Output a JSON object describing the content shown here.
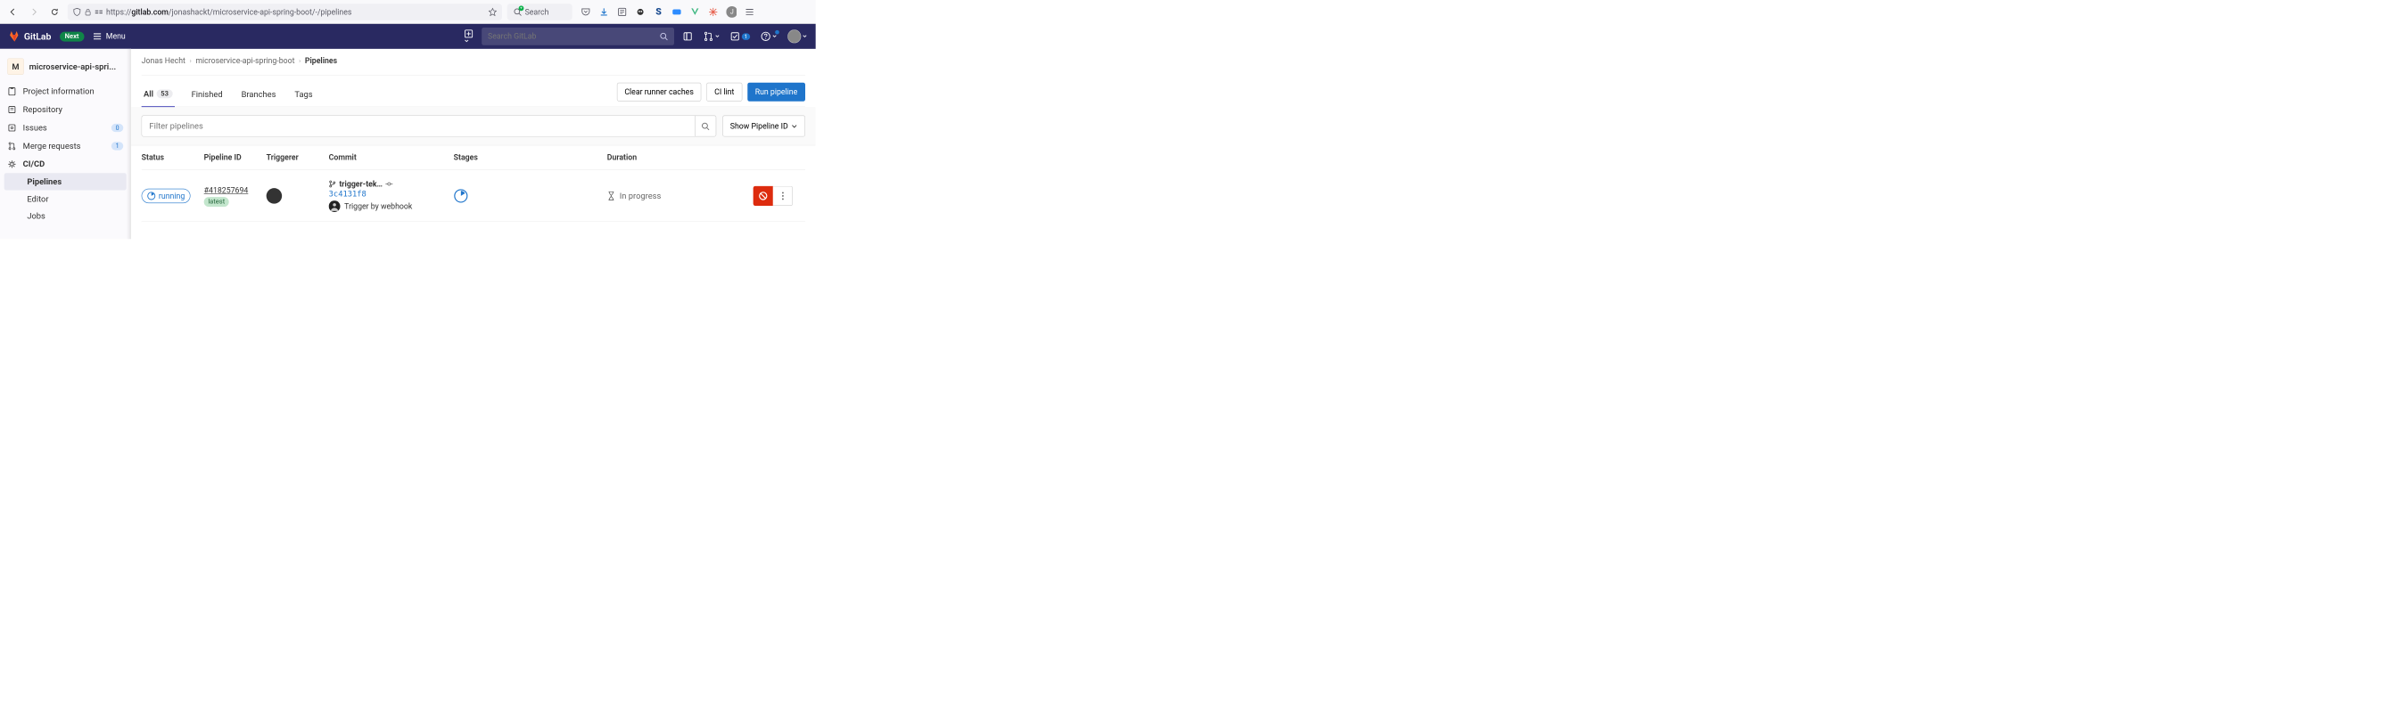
{
  "browser": {
    "url_prefix": "https://",
    "url_bold": "gitlab.com",
    "url_rest": "/jonashackt/microservice-api-spring-boot/-/pipelines",
    "search_placeholder": "Search"
  },
  "gitlab_nav": {
    "logo_text": "GitLab",
    "next_badge": "Next",
    "menu_label": "Menu",
    "search_placeholder": "Search GitLab",
    "todo_count": "1"
  },
  "sidebar": {
    "project_letter": "M",
    "project_name": "microservice-api-spri...",
    "items": [
      {
        "label": "Project information"
      },
      {
        "label": "Repository"
      },
      {
        "label": "Issues",
        "count": "0"
      },
      {
        "label": "Merge requests",
        "count": "1"
      },
      {
        "label": "CI/CD"
      }
    ],
    "subs": [
      {
        "label": "Pipelines"
      },
      {
        "label": "Editor"
      },
      {
        "label": "Jobs"
      }
    ]
  },
  "breadcrumbs": [
    "Jonas Hecht",
    "microservice-api-spring-boot",
    "Pipelines"
  ],
  "tabs": {
    "all": "All",
    "all_count": "53",
    "finished": "Finished",
    "branches": "Branches",
    "tags": "Tags"
  },
  "buttons": {
    "clear_caches": "Clear runner caches",
    "ci_lint": "CI lint",
    "run_pipeline": "Run pipeline",
    "show_pipeline": "Show Pipeline ID"
  },
  "filter_placeholder": "Filter pipelines",
  "columns": {
    "status": "Status",
    "pipeline_id": "Pipeline ID",
    "triggerer": "Triggerer",
    "commit": "Commit",
    "stages": "Stages",
    "duration": "Duration"
  },
  "row": {
    "status": "running",
    "pipeline_id": "#418257694",
    "badge": "latest",
    "branch": "trigger-tek…",
    "sha": "3c4131f8",
    "message": "Trigger by webhook",
    "duration": "In progress"
  }
}
